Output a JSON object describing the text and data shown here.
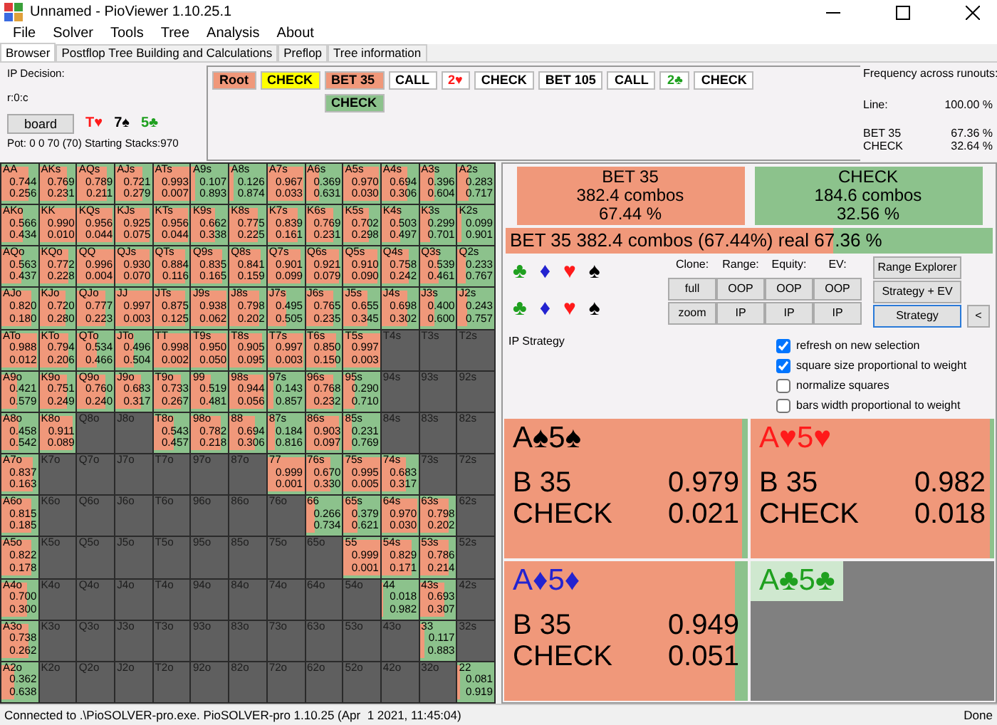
{
  "window": {
    "title": "Unnamed - PioViewer 1.10.25.1"
  },
  "menu": [
    "File",
    "Solver",
    "Tools",
    "Tree",
    "Analysis",
    "About"
  ],
  "tabs": [
    {
      "label": "Browser",
      "selected": true
    },
    {
      "label": "Postflop Tree Building and Calculations",
      "selected": false
    },
    {
      "label": "Preflop",
      "selected": false
    },
    {
      "label": "Tree information",
      "selected": false
    }
  ],
  "decision": {
    "title": "IP Decision:",
    "node": "r:0:c",
    "board_button": "board",
    "pot": "Pot: 0 0 70 (70) Starting Stacks:970",
    "board": [
      {
        "label": "T♥",
        "color": "#ff1a1a"
      },
      {
        "label": "7♠",
        "color": "#000000"
      },
      {
        "label": "5♣",
        "color": "#1fa01f"
      }
    ]
  },
  "tree": [
    {
      "label": "Root",
      "kind": "action",
      "color": "#f0987a"
    },
    {
      "label": "CHECK",
      "kind": "action",
      "color": "#ffff00"
    },
    {
      "label": "BET 35",
      "kind": "action",
      "color": "#f0987a",
      "children": [
        {
          "label": "CHECK",
          "kind": "action",
          "color": "#8cc28c"
        }
      ]
    },
    {
      "label": "CALL",
      "kind": "action",
      "color": "#ffffff"
    },
    {
      "label": "2♥",
      "kind": "card",
      "color": "#ff1a1a"
    },
    {
      "label": "CHECK",
      "kind": "action",
      "color": "#ffffff"
    },
    {
      "label": "BET 105",
      "kind": "action",
      "color": "#ffffff"
    },
    {
      "label": "CALL",
      "kind": "action",
      "color": "#ffffff"
    },
    {
      "label": "2♣",
      "kind": "card",
      "color": "#1fa01f"
    },
    {
      "label": "CHECK",
      "kind": "action",
      "color": "#ffffff"
    }
  ],
  "frequency": {
    "title": "Frequency across runouts:",
    "rows": [
      {
        "label": "Line:",
        "value": "100.00 %"
      },
      {
        "label": "BET 35",
        "value": "67.36 %"
      },
      {
        "label": "CHECK",
        "value": "32.64 %"
      }
    ]
  },
  "grid": {
    "rows": [
      [
        {
          "hand": "AA",
          "kind": "split",
          "bet": "0.744",
          "check": "0.256",
          "level": 0.744
        },
        {
          "hand": "AKs",
          "kind": "split",
          "bet": "0.769",
          "check": "0.231",
          "level": 0.769
        },
        {
          "hand": "AQs",
          "kind": "split",
          "bet": "0.789",
          "check": "0.211",
          "level": 0.789
        },
        {
          "hand": "AJs",
          "kind": "split",
          "bet": "0.721",
          "check": "0.279",
          "level": 0.721
        },
        {
          "hand": "ATs",
          "kind": "split",
          "bet": "0.993",
          "check": "0.007",
          "level": 0.993
        },
        {
          "hand": "A9s",
          "kind": "split",
          "bet": "0.107",
          "check": "0.893",
          "level": 0.107
        },
        {
          "hand": "A8s",
          "kind": "split",
          "bet": "0.126",
          "check": "0.874",
          "level": 0.126
        },
        {
          "hand": "A7s",
          "kind": "split",
          "bet": "0.967",
          "check": "0.033",
          "level": 0.967
        },
        {
          "hand": "A6s",
          "kind": "split",
          "bet": "0.369",
          "check": "0.631",
          "level": 0.369
        },
        {
          "hand": "A5s",
          "kind": "split",
          "bet": "0.970",
          "check": "0.030",
          "level": 0.97
        },
        {
          "hand": "A4s",
          "kind": "split",
          "bet": "0.694",
          "check": "0.306",
          "level": 0.694
        },
        {
          "hand": "A3s",
          "kind": "split",
          "bet": "0.396",
          "check": "0.604",
          "level": 0.396
        },
        {
          "hand": "A2s",
          "kind": "split",
          "bet": "0.283",
          "check": "0.717",
          "level": 0.283
        }
      ],
      [
        {
          "hand": "AKo",
          "kind": "split",
          "bet": "0.566",
          "check": "0.434",
          "level": 0.566
        },
        {
          "hand": "KK",
          "kind": "split",
          "bet": "0.990",
          "check": "0.010",
          "level": 0.99
        },
        {
          "hand": "KQs",
          "kind": "split",
          "bet": "0.956",
          "check": "0.044",
          "level": 0.956
        },
        {
          "hand": "KJs",
          "kind": "split",
          "bet": "0.925",
          "check": "0.075",
          "level": 0.925
        },
        {
          "hand": "KTs",
          "kind": "split",
          "bet": "0.956",
          "check": "0.044",
          "level": 0.956
        },
        {
          "hand": "K9s",
          "kind": "split",
          "bet": "0.662",
          "check": "0.338",
          "level": 0.662
        },
        {
          "hand": "K8s",
          "kind": "split",
          "bet": "0.775",
          "check": "0.225",
          "level": 0.775
        },
        {
          "hand": "K7s",
          "kind": "split",
          "bet": "0.839",
          "check": "0.161",
          "level": 0.839
        },
        {
          "hand": "K6s",
          "kind": "split",
          "bet": "0.769",
          "check": "0.231",
          "level": 0.769
        },
        {
          "hand": "K5s",
          "kind": "split",
          "bet": "0.702",
          "check": "0.298",
          "level": 0.702
        },
        {
          "hand": "K4s",
          "kind": "split",
          "bet": "0.503",
          "check": "0.497",
          "level": 0.503
        },
        {
          "hand": "K3s",
          "kind": "split",
          "bet": "0.299",
          "check": "0.701",
          "level": 0.299
        },
        {
          "hand": "K2s",
          "kind": "split",
          "bet": "0.099",
          "check": "0.901",
          "level": 0.099
        }
      ],
      [
        {
          "hand": "AQo",
          "kind": "split",
          "bet": "0.563",
          "check": "0.437",
          "level": 0.563
        },
        {
          "hand": "KQo",
          "kind": "split",
          "bet": "0.772",
          "check": "0.228",
          "level": 0.772
        },
        {
          "hand": "QQ",
          "kind": "split",
          "bet": "0.996",
          "check": "0.004",
          "level": 0.996
        },
        {
          "hand": "QJs",
          "kind": "split",
          "bet": "0.930",
          "check": "0.070",
          "level": 0.93
        },
        {
          "hand": "QTs",
          "kind": "split",
          "bet": "0.884",
          "check": "0.116",
          "level": 0.884
        },
        {
          "hand": "Q9s",
          "kind": "split",
          "bet": "0.835",
          "check": "0.165",
          "level": 0.835
        },
        {
          "hand": "Q8s",
          "kind": "split",
          "bet": "0.841",
          "check": "0.159",
          "level": 0.841
        },
        {
          "hand": "Q7s",
          "kind": "split",
          "bet": "0.901",
          "check": "0.099",
          "level": 0.901
        },
        {
          "hand": "Q6s",
          "kind": "split",
          "bet": "0.921",
          "check": "0.079",
          "level": 0.921
        },
        {
          "hand": "Q5s",
          "kind": "split",
          "bet": "0.910",
          "check": "0.090",
          "level": 0.91
        },
        {
          "hand": "Q4s",
          "kind": "split",
          "bet": "0.758",
          "check": "0.242",
          "level": 0.758
        },
        {
          "hand": "Q3s",
          "kind": "split",
          "bet": "0.539",
          "check": "0.461",
          "level": 0.539
        },
        {
          "hand": "Q2s",
          "kind": "split",
          "bet": "0.233",
          "check": "0.767",
          "level": 0.233
        }
      ],
      [
        {
          "hand": "AJo",
          "kind": "split",
          "bet": "0.820",
          "check": "0.180",
          "level": 0.82
        },
        {
          "hand": "KJo",
          "kind": "split",
          "bet": "0.720",
          "check": "0.280",
          "level": 0.72
        },
        {
          "hand": "QJo",
          "kind": "split",
          "bet": "0.777",
          "check": "0.223",
          "level": 0.777
        },
        {
          "hand": "JJ",
          "kind": "split",
          "bet": "0.997",
          "check": "0.003",
          "level": 0.997
        },
        {
          "hand": "JTs",
          "kind": "split",
          "bet": "0.875",
          "check": "0.125",
          "level": 0.875
        },
        {
          "hand": "J9s",
          "kind": "split",
          "bet": "0.938",
          "check": "0.062",
          "level": 0.938
        },
        {
          "hand": "J8s",
          "kind": "split",
          "bet": "0.798",
          "check": "0.202",
          "level": 0.798
        },
        {
          "hand": "J7s",
          "kind": "split",
          "bet": "0.495",
          "check": "0.505",
          "level": 0.495
        },
        {
          "hand": "J6s",
          "kind": "split",
          "bet": "0.765",
          "check": "0.235",
          "level": 0.765
        },
        {
          "hand": "J5s",
          "kind": "split",
          "bet": "0.655",
          "check": "0.345",
          "level": 0.655
        },
        {
          "hand": "J4s",
          "kind": "split",
          "bet": "0.698",
          "check": "0.302",
          "level": 0.698
        },
        {
          "hand": "J3s",
          "kind": "split",
          "bet": "0.400",
          "check": "0.600",
          "level": 0.4
        },
        {
          "hand": "J2s",
          "kind": "split",
          "bet": "0.243",
          "check": "0.757",
          "level": 0.243
        }
      ],
      [
        {
          "hand": "ATo",
          "kind": "split",
          "bet": "0.988",
          "check": "0.012",
          "level": 0.988
        },
        {
          "hand": "KTo",
          "kind": "split",
          "bet": "0.794",
          "check": "0.206",
          "level": 0.794
        },
        {
          "hand": "QTo",
          "kind": "split",
          "bet": "0.534",
          "check": "0.466",
          "level": 0.534
        },
        {
          "hand": "JTo",
          "kind": "split",
          "bet": "0.496",
          "check": "0.504",
          "level": 0.496
        },
        {
          "hand": "TT",
          "kind": "split",
          "bet": "0.998",
          "check": "0.002",
          "level": 0.998
        },
        {
          "hand": "T9s",
          "kind": "split",
          "bet": "0.950",
          "check": "0.050",
          "level": 0.95
        },
        {
          "hand": "T8s",
          "kind": "split",
          "bet": "0.905",
          "check": "0.095",
          "level": 0.905
        },
        {
          "hand": "T7s",
          "kind": "split",
          "bet": "0.997",
          "check": "0.003",
          "level": 0.997
        },
        {
          "hand": "T6s",
          "kind": "split",
          "bet": "0.850",
          "check": "0.150",
          "level": 0.85
        },
        {
          "hand": "T5s",
          "kind": "split",
          "bet": "0.997",
          "check": "0.003",
          "level": 0.997
        },
        {
          "hand": "T4s",
          "kind": "empty"
        },
        {
          "hand": "T3s",
          "kind": "empty"
        },
        {
          "hand": "T2s",
          "kind": "empty"
        }
      ],
      [
        {
          "hand": "A9o",
          "kind": "split",
          "bet": "0.421",
          "check": "0.579",
          "level": 0.421
        },
        {
          "hand": "K9o",
          "kind": "split",
          "bet": "0.751",
          "check": "0.249",
          "level": 0.751
        },
        {
          "hand": "Q9o",
          "kind": "split",
          "bet": "0.760",
          "check": "0.240",
          "level": 0.76
        },
        {
          "hand": "J9o",
          "kind": "split",
          "bet": "0.683",
          "check": "0.317",
          "level": 0.683
        },
        {
          "hand": "T9o",
          "kind": "split",
          "bet": "0.733",
          "check": "0.267",
          "level": 0.733
        },
        {
          "hand": "99",
          "kind": "split",
          "bet": "0.519",
          "check": "0.481",
          "level": 0.519
        },
        {
          "hand": "98s",
          "kind": "split",
          "bet": "0.944",
          "check": "0.056",
          "level": 0.944
        },
        {
          "hand": "97s",
          "kind": "split",
          "bet": "0.143",
          "check": "0.857",
          "level": 0.143
        },
        {
          "hand": "96s",
          "kind": "split",
          "bet": "0.768",
          "check": "0.232",
          "level": 0.768
        },
        {
          "hand": "95s",
          "kind": "split",
          "bet": "0.290",
          "check": "0.710",
          "level": 0.29
        },
        {
          "hand": "94s",
          "kind": "empty"
        },
        {
          "hand": "93s",
          "kind": "empty"
        },
        {
          "hand": "92s",
          "kind": "empty"
        }
      ],
      [
        {
          "hand": "A8o",
          "kind": "split",
          "bet": "0.458",
          "check": "0.542",
          "level": 0.458
        },
        {
          "hand": "K8o",
          "kind": "split",
          "bet": "0.911",
          "check": "0.089",
          "level": 0.911
        },
        {
          "hand": "Q8o",
          "kind": "empty"
        },
        {
          "hand": "J8o",
          "kind": "empty"
        },
        {
          "hand": "T8o",
          "kind": "split",
          "bet": "0.543",
          "check": "0.457",
          "level": 0.543
        },
        {
          "hand": "98o",
          "kind": "split",
          "bet": "0.782",
          "check": "0.218",
          "level": 0.782
        },
        {
          "hand": "88",
          "kind": "split",
          "bet": "0.694",
          "check": "0.306",
          "level": 0.694
        },
        {
          "hand": "87s",
          "kind": "split",
          "bet": "0.184",
          "check": "0.816",
          "level": 0.184
        },
        {
          "hand": "86s",
          "kind": "split",
          "bet": "0.903",
          "check": "0.097",
          "level": 0.903
        },
        {
          "hand": "85s",
          "kind": "split",
          "bet": "0.231",
          "check": "0.769",
          "level": 0.231
        },
        {
          "hand": "84s",
          "kind": "empty"
        },
        {
          "hand": "83s",
          "kind": "empty"
        },
        {
          "hand": "82s",
          "kind": "empty"
        }
      ],
      [
        {
          "hand": "A7o",
          "kind": "split",
          "bet": "0.837",
          "check": "0.163",
          "level": 0.837
        },
        {
          "hand": "K7o",
          "kind": "empty"
        },
        {
          "hand": "Q7o",
          "kind": "empty"
        },
        {
          "hand": "J7o",
          "kind": "empty"
        },
        {
          "hand": "T7o",
          "kind": "empty"
        },
        {
          "hand": "97o",
          "kind": "empty"
        },
        {
          "hand": "87o",
          "kind": "empty"
        },
        {
          "hand": "77",
          "kind": "split",
          "bet": "0.999",
          "check": "0.001",
          "level": 0.999
        },
        {
          "hand": "76s",
          "kind": "split",
          "bet": "0.670",
          "check": "0.330",
          "level": 0.67
        },
        {
          "hand": "75s",
          "kind": "split",
          "bet": "0.995",
          "check": "0.005",
          "level": 0.995
        },
        {
          "hand": "74s",
          "kind": "split",
          "bet": "0.683",
          "check": "0.317",
          "level": 0.683
        },
        {
          "hand": "73s",
          "kind": "empty"
        },
        {
          "hand": "72s",
          "kind": "empty"
        }
      ],
      [
        {
          "hand": "A6o",
          "kind": "split",
          "bet": "0.815",
          "check": "0.185",
          "level": 0.815
        },
        {
          "hand": "K6o",
          "kind": "empty"
        },
        {
          "hand": "Q6o",
          "kind": "empty"
        },
        {
          "hand": "J6o",
          "kind": "empty"
        },
        {
          "hand": "T6o",
          "kind": "empty"
        },
        {
          "hand": "96o",
          "kind": "empty"
        },
        {
          "hand": "86o",
          "kind": "empty"
        },
        {
          "hand": "76o",
          "kind": "empty"
        },
        {
          "hand": "66",
          "kind": "split",
          "bet": "0.266",
          "check": "0.734",
          "level": 0.266
        },
        {
          "hand": "65s",
          "kind": "split",
          "bet": "0.379",
          "check": "0.621",
          "level": 0.379
        },
        {
          "hand": "64s",
          "kind": "split",
          "bet": "0.970",
          "check": "0.030",
          "level": 0.97
        },
        {
          "hand": "63s",
          "kind": "split",
          "bet": "0.798",
          "check": "0.202",
          "level": 0.798
        },
        {
          "hand": "62s",
          "kind": "empty"
        }
      ],
      [
        {
          "hand": "A5o",
          "kind": "split",
          "bet": "0.822",
          "check": "0.178",
          "level": 0.822
        },
        {
          "hand": "K5o",
          "kind": "empty"
        },
        {
          "hand": "Q5o",
          "kind": "empty"
        },
        {
          "hand": "J5o",
          "kind": "empty"
        },
        {
          "hand": "T5o",
          "kind": "empty"
        },
        {
          "hand": "95o",
          "kind": "empty"
        },
        {
          "hand": "85o",
          "kind": "empty"
        },
        {
          "hand": "75o",
          "kind": "empty"
        },
        {
          "hand": "65o",
          "kind": "empty"
        },
        {
          "hand": "55",
          "kind": "split",
          "bet": "0.999",
          "check": "0.001",
          "level": 0.999
        },
        {
          "hand": "54s",
          "kind": "split",
          "bet": "0.829",
          "check": "0.171",
          "level": 0.829
        },
        {
          "hand": "53s",
          "kind": "split",
          "bet": "0.786",
          "check": "0.214",
          "level": 0.786
        },
        {
          "hand": "52s",
          "kind": "empty"
        }
      ],
      [
        {
          "hand": "A4o",
          "kind": "split",
          "bet": "0.700",
          "check": "0.300",
          "level": 0.7
        },
        {
          "hand": "K4o",
          "kind": "empty"
        },
        {
          "hand": "Q4o",
          "kind": "empty"
        },
        {
          "hand": "J4o",
          "kind": "empty"
        },
        {
          "hand": "T4o",
          "kind": "empty"
        },
        {
          "hand": "94o",
          "kind": "empty"
        },
        {
          "hand": "84o",
          "kind": "empty"
        },
        {
          "hand": "74o",
          "kind": "empty"
        },
        {
          "hand": "64o",
          "kind": "empty"
        },
        {
          "hand": "54o",
          "kind": "empty"
        },
        {
          "hand": "44",
          "kind": "split",
          "bet": "0.018",
          "check": "0.982",
          "level": 0.018
        },
        {
          "hand": "43s",
          "kind": "split",
          "bet": "0.693",
          "check": "0.307",
          "level": 0.693
        },
        {
          "hand": "42s",
          "kind": "empty"
        }
      ],
      [
        {
          "hand": "A3o",
          "kind": "split",
          "bet": "0.738",
          "check": "0.262",
          "level": 0.738
        },
        {
          "hand": "K3o",
          "kind": "empty"
        },
        {
          "hand": "Q3o",
          "kind": "empty"
        },
        {
          "hand": "J3o",
          "kind": "empty"
        },
        {
          "hand": "T3o",
          "kind": "empty"
        },
        {
          "hand": "93o",
          "kind": "empty"
        },
        {
          "hand": "83o",
          "kind": "empty"
        },
        {
          "hand": "73o",
          "kind": "empty"
        },
        {
          "hand": "63o",
          "kind": "empty"
        },
        {
          "hand": "53o",
          "kind": "empty"
        },
        {
          "hand": "43o",
          "kind": "empty"
        },
        {
          "hand": "33",
          "kind": "split",
          "bet": "0.117",
          "check": "0.883",
          "level": 0.117
        },
        {
          "hand": "32s",
          "kind": "empty"
        }
      ],
      [
        {
          "hand": "A2o",
          "kind": "split",
          "bet": "0.362",
          "check": "0.638",
          "level": 0.362
        },
        {
          "hand": "K2o",
          "kind": "empty"
        },
        {
          "hand": "Q2o",
          "kind": "empty"
        },
        {
          "hand": "J2o",
          "kind": "empty"
        },
        {
          "hand": "T2o",
          "kind": "empty"
        },
        {
          "hand": "92o",
          "kind": "empty"
        },
        {
          "hand": "82o",
          "kind": "empty"
        },
        {
          "hand": "72o",
          "kind": "empty"
        },
        {
          "hand": "62o",
          "kind": "empty"
        },
        {
          "hand": "52o",
          "kind": "empty"
        },
        {
          "hand": "42o",
          "kind": "empty"
        },
        {
          "hand": "32o",
          "kind": "empty"
        },
        {
          "hand": "22",
          "kind": "split",
          "bet": "0.081",
          "check": "0.919",
          "level": 0.081
        }
      ]
    ]
  },
  "actions": [
    {
      "label": "BET 35",
      "combos": "382.4 combos",
      "percent": "67.44 %",
      "color": "#f0987a"
    },
    {
      "label": "CHECK",
      "combos": "184.6 combos",
      "percent": "32.56 %",
      "color": "#8cc28c"
    }
  ],
  "summary": {
    "text": "BET 35   382.4 combos (67.44%) real  67.36 %",
    "level": 0.6736
  },
  "suit_rows": [
    [
      {
        "label": "♣",
        "color": "#1fa01f"
      },
      {
        "label": "♦",
        "color": "#2323d0"
      },
      {
        "label": "♥",
        "color": "#ff1a1a"
      },
      {
        "label": "♠",
        "color": "#000000"
      }
    ],
    [
      {
        "label": "♣",
        "color": "#1fa01f"
      },
      {
        "label": "♦",
        "color": "#2323d0"
      },
      {
        "label": "♥",
        "color": "#ff1a1a"
      },
      {
        "label": "♠",
        "color": "#000000"
      }
    ]
  ],
  "controls": {
    "columns": [
      {
        "label": "Clone:",
        "buttons": [
          "full",
          "zoom"
        ]
      },
      {
        "label": "Range:",
        "buttons": [
          "OOP",
          "IP"
        ]
      },
      {
        "label": "Equity:",
        "buttons": [
          "OOP",
          "IP"
        ]
      },
      {
        "label": "EV:",
        "buttons": [
          "OOP",
          "IP"
        ]
      }
    ],
    "views": [
      {
        "label": "Range Explorer",
        "selected": false
      },
      {
        "label": "Strategy + EV",
        "selected": false
      },
      {
        "label": "Strategy",
        "selected": true
      }
    ],
    "collapse": "<"
  },
  "strategy_label": "IP Strategy",
  "options": [
    {
      "label": "refresh on new selection",
      "checked": true
    },
    {
      "label": "square size proportional to weight",
      "checked": true
    },
    {
      "label": "normalize squares",
      "checked": false
    },
    {
      "label": "bars width proportional to weight",
      "checked": false
    }
  ],
  "combos": [
    {
      "title": "A♠5♠",
      "color": "#000000",
      "kind": "split",
      "level": 0.979,
      "rows": [
        {
          "action": "B 35",
          "value": "0.979"
        },
        {
          "action": "CHECK",
          "value": "0.021"
        }
      ]
    },
    {
      "title": "A♥5♥",
      "color": "#ff1a1a",
      "kind": "split",
      "level": 0.982,
      "rows": [
        {
          "action": "B 35",
          "value": "0.982"
        },
        {
          "action": "CHECK",
          "value": "0.018"
        }
      ]
    },
    {
      "title": "A♦5♦",
      "color": "#2323d0",
      "kind": "split",
      "level": 0.949,
      "rows": [
        {
          "action": "B 35",
          "value": "0.949"
        },
        {
          "action": "CHECK",
          "value": "0.051"
        }
      ]
    },
    {
      "title": "A♣5♣",
      "color": "#1fa01f",
      "kind": "empty"
    }
  ],
  "status_bar": {
    "left": "Connected to .\\PioSOLVER-pro.exe. PioSOLVER-pro 1.10.25 (Apr  1 2021, 11:45:04)",
    "right": "Done"
  }
}
